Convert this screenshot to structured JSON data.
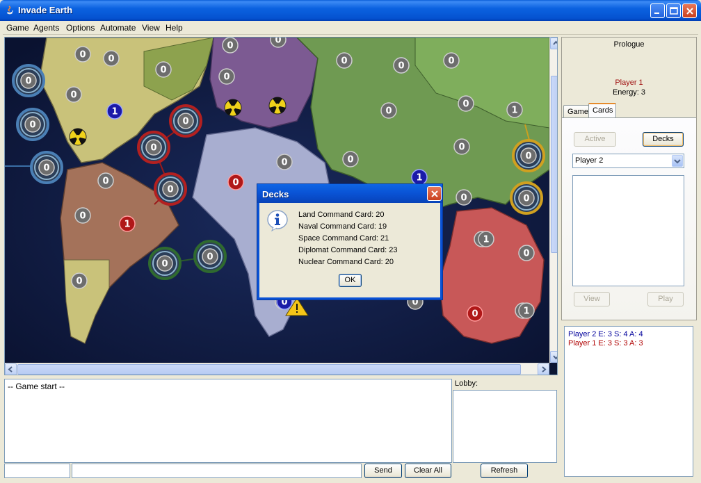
{
  "window": {
    "title": "Invade Earth"
  },
  "menu": [
    "Game",
    "Agents",
    "Options",
    "Automate",
    "View",
    "Help"
  ],
  "map": {
    "ocean_color": "#0c1634",
    "armies": [
      "0",
      "0",
      "0",
      "0",
      "0",
      "0",
      "0",
      "0",
      "0",
      "0",
      "0",
      "1",
      "0",
      "0",
      "0",
      "0",
      "0",
      "0",
      "0",
      "0",
      "0",
      "0",
      "0",
      "0",
      "0",
      "0",
      "0",
      "0",
      "0",
      "0",
      "1",
      "0",
      "1",
      "1",
      "0",
      "0",
      "0",
      "0",
      "0",
      "0",
      "1",
      "1",
      "0",
      "0"
    ]
  },
  "dialog": {
    "title": "Decks",
    "icon": "info-icon",
    "lines": [
      "Land Command Card:  20",
      "Naval Command Card:  19",
      "Space Command Card:  21",
      "Diplomat Command Card:  23",
      "Nuclear Command Card:  20"
    ],
    "ok_label": "OK"
  },
  "right_panel": {
    "phase": "Prologue",
    "current_player": "Player 1",
    "energy": "Energy:  3",
    "tabs": [
      "Game",
      "Cards"
    ],
    "active_tab": "Cards",
    "buttons": {
      "active": "Active",
      "decks": "Decks",
      "view": "View",
      "play": "Play"
    },
    "player_select": "Player 2"
  },
  "stats": [
    {
      "text": "Player 2 E: 3 S: 4 A: 4",
      "color": "#00009c"
    },
    {
      "text": "Player 1 E: 3 S: 3 A: 3",
      "color": "#b00000"
    }
  ],
  "log": {
    "text": "-- Game start --"
  },
  "lobby": {
    "label": "Lobby:"
  },
  "bottom_buttons": {
    "send": "Send",
    "clear_all": "Clear All",
    "refresh": "Refresh"
  },
  "colors": {
    "player1": "#b00000",
    "player2": "#00009c",
    "titlebar": "#0b62e0"
  }
}
